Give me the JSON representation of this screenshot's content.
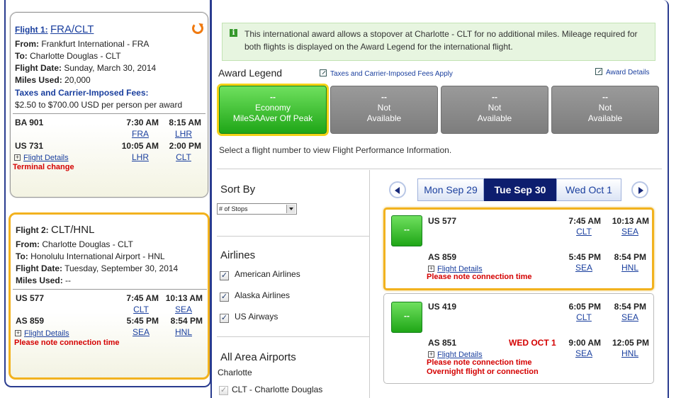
{
  "flight1": {
    "prefix": "Flight 1:",
    "route": "FRA/CLT",
    "from_label": "From:",
    "from": "Frankfurt International - FRA",
    "to_label": "To:",
    "to": "Charlotte Douglas - CLT",
    "date_label": "Flight Date:",
    "date": "Sunday, March 30, 2014",
    "miles_label": "Miles Used:",
    "miles": "20,000",
    "fees_label": "Taxes and Carrier-Imposed Fees:",
    "fees": "$2.50 to $700.00 USD per person per award",
    "segments": [
      {
        "flight": "BA 901",
        "dep_time": "7:30 AM",
        "arr_time": "8:15 AM",
        "dep_ap": "FRA",
        "arr_ap": "LHR"
      },
      {
        "flight": "US 731",
        "dep_time": "10:05 AM",
        "arr_time": "2:00 PM",
        "dep_ap": "LHR",
        "arr_ap": "CLT"
      }
    ],
    "details_link": "Flight Details",
    "notice": "Terminal change"
  },
  "flight2": {
    "prefix": "Flight 2:",
    "route": "CLT/HNL",
    "from_label": "From:",
    "from": "Charlotte Douglas - CLT",
    "to_label": "To:",
    "to": "Honolulu International Airport - HNL",
    "date_label": "Flight Date:",
    "date": "Tuesday, September 30, 2014",
    "miles_label": "Miles Used:",
    "miles": "--",
    "segments": [
      {
        "flight": "US 577",
        "dep_time": "7:45 AM",
        "arr_time": "10:13 AM",
        "dep_ap": "CLT",
        "arr_ap": "SEA"
      },
      {
        "flight": "AS 859",
        "dep_time": "5:45 PM",
        "arr_time": "8:54 PM",
        "dep_ap": "SEA",
        "arr_ap": "HNL"
      }
    ],
    "details_link": "Flight Details",
    "notice": "Please note connection time"
  },
  "info": {
    "icon": "i",
    "text": "This international award allows a stopover at Charlotte - CLT for no additional miles. Mileage required for both flights is displayed on the Award Legend for the international flight."
  },
  "award_legend": {
    "title": "Award Legend",
    "fees_link": "Taxes and Carrier-Imposed Fees Apply",
    "details_link": "Award Details",
    "boxes": [
      {
        "value": "--",
        "line1": "Economy",
        "line2": "MileSAAver Off Peak"
      },
      {
        "value": "--",
        "line1": "Not",
        "line2": "Available"
      },
      {
        "value": "--",
        "line1": "Not",
        "line2": "Available"
      },
      {
        "value": "--",
        "line1": "Not",
        "line2": "Available"
      }
    ]
  },
  "select_note": "Select a flight number to view Flight Performance Information.",
  "sort": {
    "title": "Sort By",
    "selected": "# of Stops"
  },
  "airlines": {
    "title": "Airlines",
    "items": [
      "American Airlines",
      "Alaska Airlines",
      "US Airways"
    ]
  },
  "airports": {
    "title": "All Area Airports",
    "city": "Charlotte",
    "items": [
      "CLT - Charlotte Douglas"
    ]
  },
  "date_tabs": [
    "Mon Sep 29",
    "Tue Sep 30",
    "Wed Oct 1"
  ],
  "results": [
    {
      "button": "--",
      "seg1": {
        "flight": "US 577",
        "dep_time": "7:45 AM",
        "arr_time": "10:13 AM",
        "dep_ap": "CLT",
        "arr_ap": "SEA"
      },
      "seg2": {
        "flight": "AS 859",
        "dep_time": "5:45 PM",
        "arr_time": "8:54 PM",
        "dep_ap": "SEA",
        "arr_ap": "HNL",
        "date_note": ""
      },
      "details_link": "Flight Details",
      "notices": [
        "Please note connection time"
      ]
    },
    {
      "button": "--",
      "seg1": {
        "flight": "US 419",
        "dep_time": "6:05 PM",
        "arr_time": "8:54 PM",
        "dep_ap": "CLT",
        "arr_ap": "SEA"
      },
      "seg2": {
        "flight": "AS 851",
        "dep_time": "9:00 AM",
        "arr_time": "12:05 PM",
        "dep_ap": "SEA",
        "arr_ap": "HNL",
        "date_note": "WED OCT 1"
      },
      "details_link": "Flight Details",
      "notices": [
        "Please note connection time",
        "Overnight flight or connection"
      ]
    }
  ]
}
